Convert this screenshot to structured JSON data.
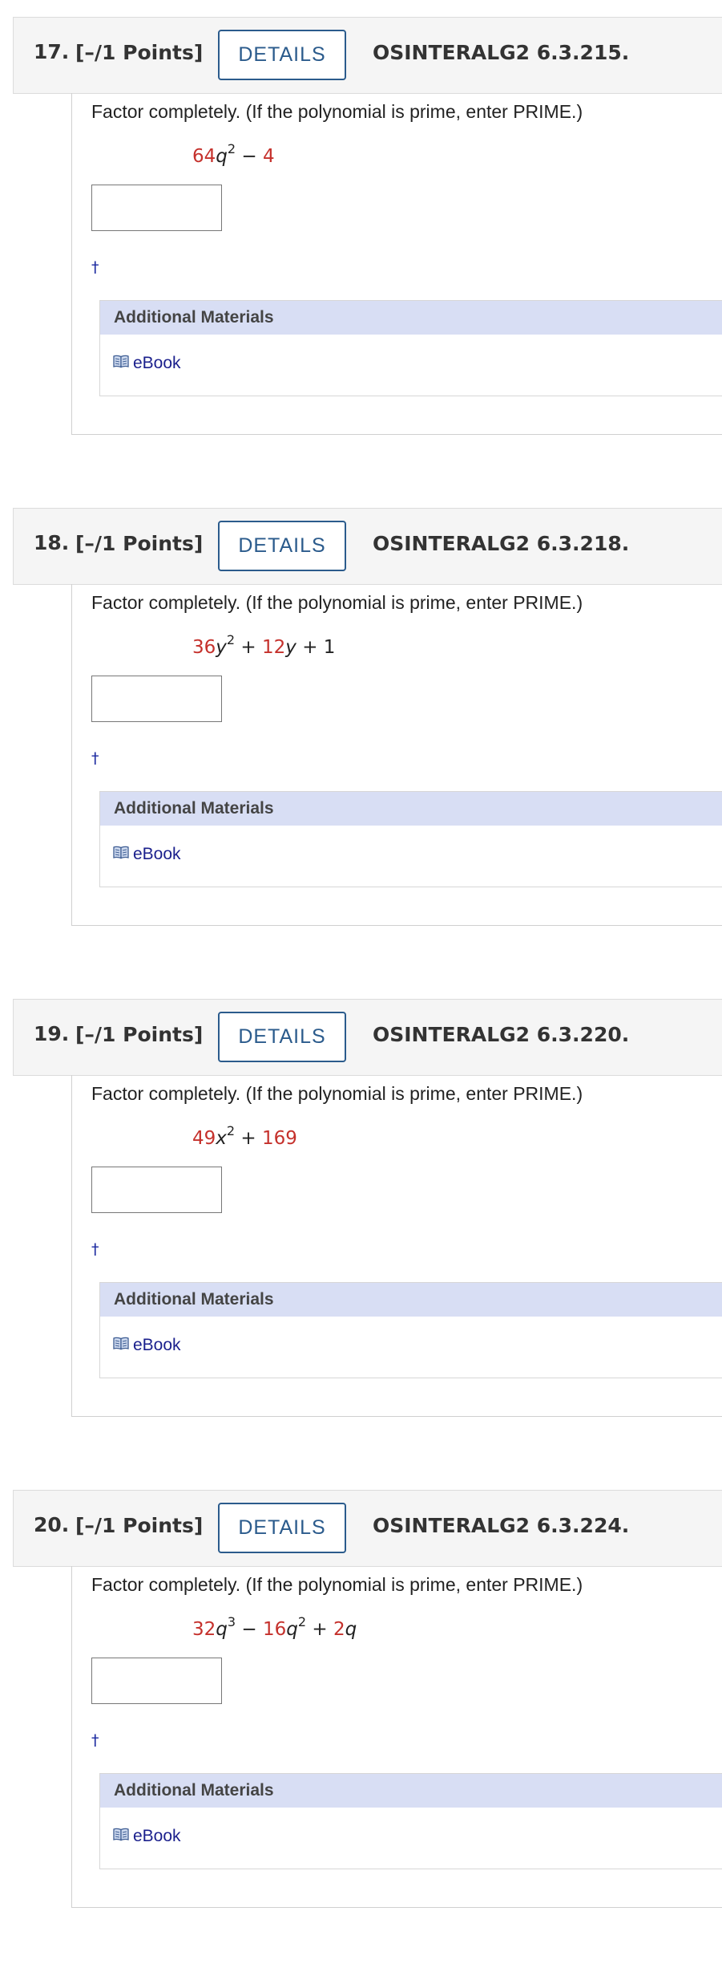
{
  "common": {
    "points": "[–/1 Points]",
    "details_label": "DETAILS",
    "prompt": "Factor completely. (If the polynomial is prime, enter PRIME.)",
    "dagger": "†",
    "additional_materials": "Additional Materials",
    "ebook": "eBook"
  },
  "questions": [
    {
      "number": "17.",
      "code": "OSINTERALG2 6.3.215.",
      "expr": [
        {
          "t": "64",
          "c": 1
        },
        {
          "t": "q",
          "v": 1
        },
        {
          "t": "2",
          "sup": 1
        },
        {
          "t": " − "
        },
        {
          "t": "4",
          "c": 1
        }
      ],
      "answer": ""
    },
    {
      "number": "18.",
      "code": "OSINTERALG2 6.3.218.",
      "expr": [
        {
          "t": "36",
          "c": 1
        },
        {
          "t": "y",
          "v": 1
        },
        {
          "t": "2",
          "sup": 1
        },
        {
          "t": " + "
        },
        {
          "t": "12",
          "c": 1
        },
        {
          "t": "y",
          "v": 1
        },
        {
          "t": " + 1"
        }
      ],
      "answer": ""
    },
    {
      "number": "19.",
      "code": "OSINTERALG2 6.3.220.",
      "expr": [
        {
          "t": "49",
          "c": 1
        },
        {
          "t": "x",
          "v": 1
        },
        {
          "t": "2",
          "sup": 1
        },
        {
          "t": " + "
        },
        {
          "t": "169",
          "c": 1
        }
      ],
      "answer": ""
    },
    {
      "number": "20.",
      "code": "OSINTERALG2 6.3.224.",
      "expr": [
        {
          "t": "32",
          "c": 1
        },
        {
          "t": "q",
          "v": 1
        },
        {
          "t": "3",
          "sup": 1
        },
        {
          "t": " − "
        },
        {
          "t": "16",
          "c": 1
        },
        {
          "t": "q",
          "v": 1
        },
        {
          "t": "2",
          "sup": 1
        },
        {
          "t": " + "
        },
        {
          "t": "2",
          "c": 1
        },
        {
          "t": "q",
          "v": 1
        }
      ],
      "answer": ""
    }
  ],
  "colors": {
    "coefficient": "#c5312c",
    "details_border": "#2b5b8c",
    "materials_header": "#d8def4",
    "link": "#1a1f8c"
  },
  "icons": {
    "ebook": "open-book-icon"
  }
}
